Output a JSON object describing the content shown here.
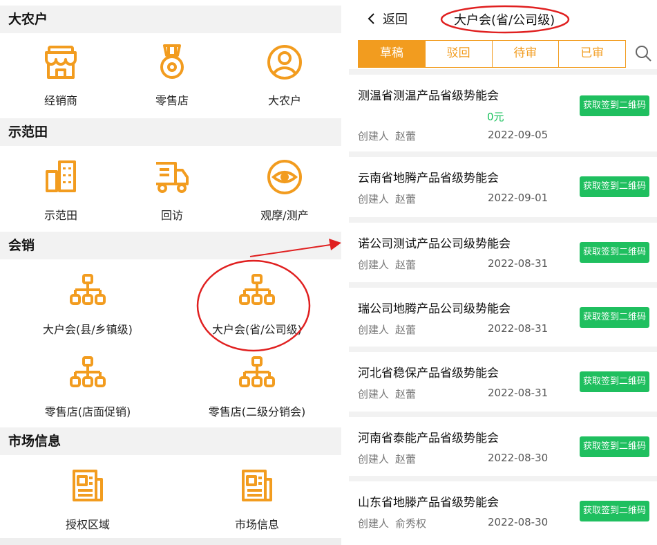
{
  "left": {
    "sections": [
      {
        "title": "大农户",
        "items": [
          {
            "label": "经销商",
            "icon": "store-icon"
          },
          {
            "label": "零售店",
            "icon": "medal-icon"
          },
          {
            "label": "大农户",
            "icon": "user-circle-icon"
          }
        ]
      },
      {
        "title": "示范田",
        "items": [
          {
            "label": "示范田",
            "icon": "building-icon"
          },
          {
            "label": "回访",
            "icon": "truck-icon"
          },
          {
            "label": "观摩/测产",
            "icon": "eye-icon"
          }
        ]
      },
      {
        "title": "会销",
        "items": [
          {
            "label": "大户会(县/乡镇级)",
            "icon": "org-chart-icon"
          },
          {
            "label": "大户会(省/公司级)",
            "icon": "org-chart-icon"
          },
          {
            "label": "零售店(店面促销)",
            "icon": "org-chart-icon"
          },
          {
            "label": "零售店(二级分销会)",
            "icon": "org-chart-icon"
          }
        ]
      },
      {
        "title": "市场信息",
        "items": [
          {
            "label": "授权区域",
            "icon": "news-icon"
          },
          {
            "label": "市场信息",
            "icon": "news-icon"
          }
        ]
      }
    ]
  },
  "right": {
    "back_label": "返回",
    "title": "大户会(省/公司级)",
    "tabs": [
      "草稿",
      "驳回",
      "待审",
      "已审"
    ],
    "active_tab": "草稿",
    "creator_label": "创建人",
    "qr_button_label": "获取签到二维码",
    "records": [
      {
        "name": "测温省测温产品省级势能会",
        "amount": "0元",
        "creator": "赵蕾",
        "date": "2022-09-05"
      },
      {
        "name": "云南省地腾产品省级势能会",
        "creator": "赵蕾",
        "date": "2022-09-01"
      },
      {
        "name": "诺公司测试产品公司级势能会",
        "creator": "赵蕾",
        "date": "2022-08-31"
      },
      {
        "name": "瑞公司地腾产品公司级势能会",
        "creator": "赵蕾",
        "date": "2022-08-31"
      },
      {
        "name": "河北省稳保产品省级势能会",
        "creator": "赵蕾",
        "date": "2022-08-31"
      },
      {
        "name": "河南省泰能产品省级势能会",
        "creator": "赵蕾",
        "date": "2022-08-30"
      },
      {
        "name": "山东省地滕产品省级势能会",
        "creator": "俞秀权",
        "date": "2022-08-30"
      }
    ]
  },
  "colors": {
    "accent": "#f29c1f",
    "green": "#1fbf5f",
    "annotation": "#e02020"
  }
}
